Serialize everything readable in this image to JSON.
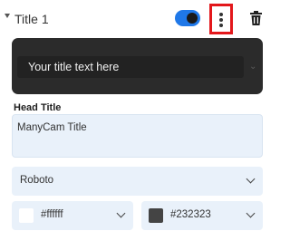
{
  "header": {
    "title": "Title 1",
    "toggle_on": true,
    "icons": {
      "expand": "caret-down-icon",
      "more": "more-vert-icon",
      "delete": "trash-icon"
    },
    "highlight_color": "#e3171b",
    "toggle_color": "#1f78e8"
  },
  "preview": {
    "text": "Your title text here",
    "background": "#2b2b2b"
  },
  "head_title": {
    "label": "Head Title",
    "value": "ManyCam Title"
  },
  "font": {
    "value": "Roboto"
  },
  "colors": {
    "text_color": "#ffffff",
    "background_color": "#232323"
  }
}
